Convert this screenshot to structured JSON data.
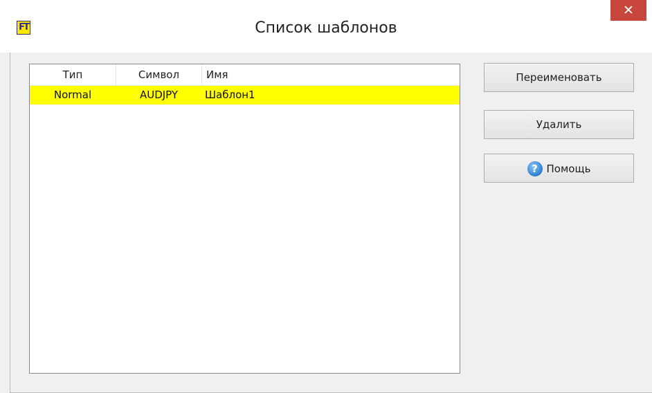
{
  "window": {
    "title": "Список шаблонов",
    "app_icon_text": "FT",
    "close_glyph": "✕"
  },
  "list": {
    "columns": [
      "Тип",
      "Символ",
      "Имя"
    ],
    "rows": [
      {
        "type": "Normal",
        "symbol": "AUDJPY",
        "name": "Шаблон1",
        "highlight_color": "#ffff00"
      }
    ]
  },
  "buttons": {
    "rename": "Переименовать",
    "delete": "Удалить",
    "help": "Помощь"
  },
  "icons": {
    "app": "ft-app-icon",
    "close": "close-icon",
    "help": "question-circle-icon"
  },
  "colors": {
    "close_button": "#c9463d",
    "selection": "#ffff00",
    "dialog_background": "#f0f0f0"
  }
}
